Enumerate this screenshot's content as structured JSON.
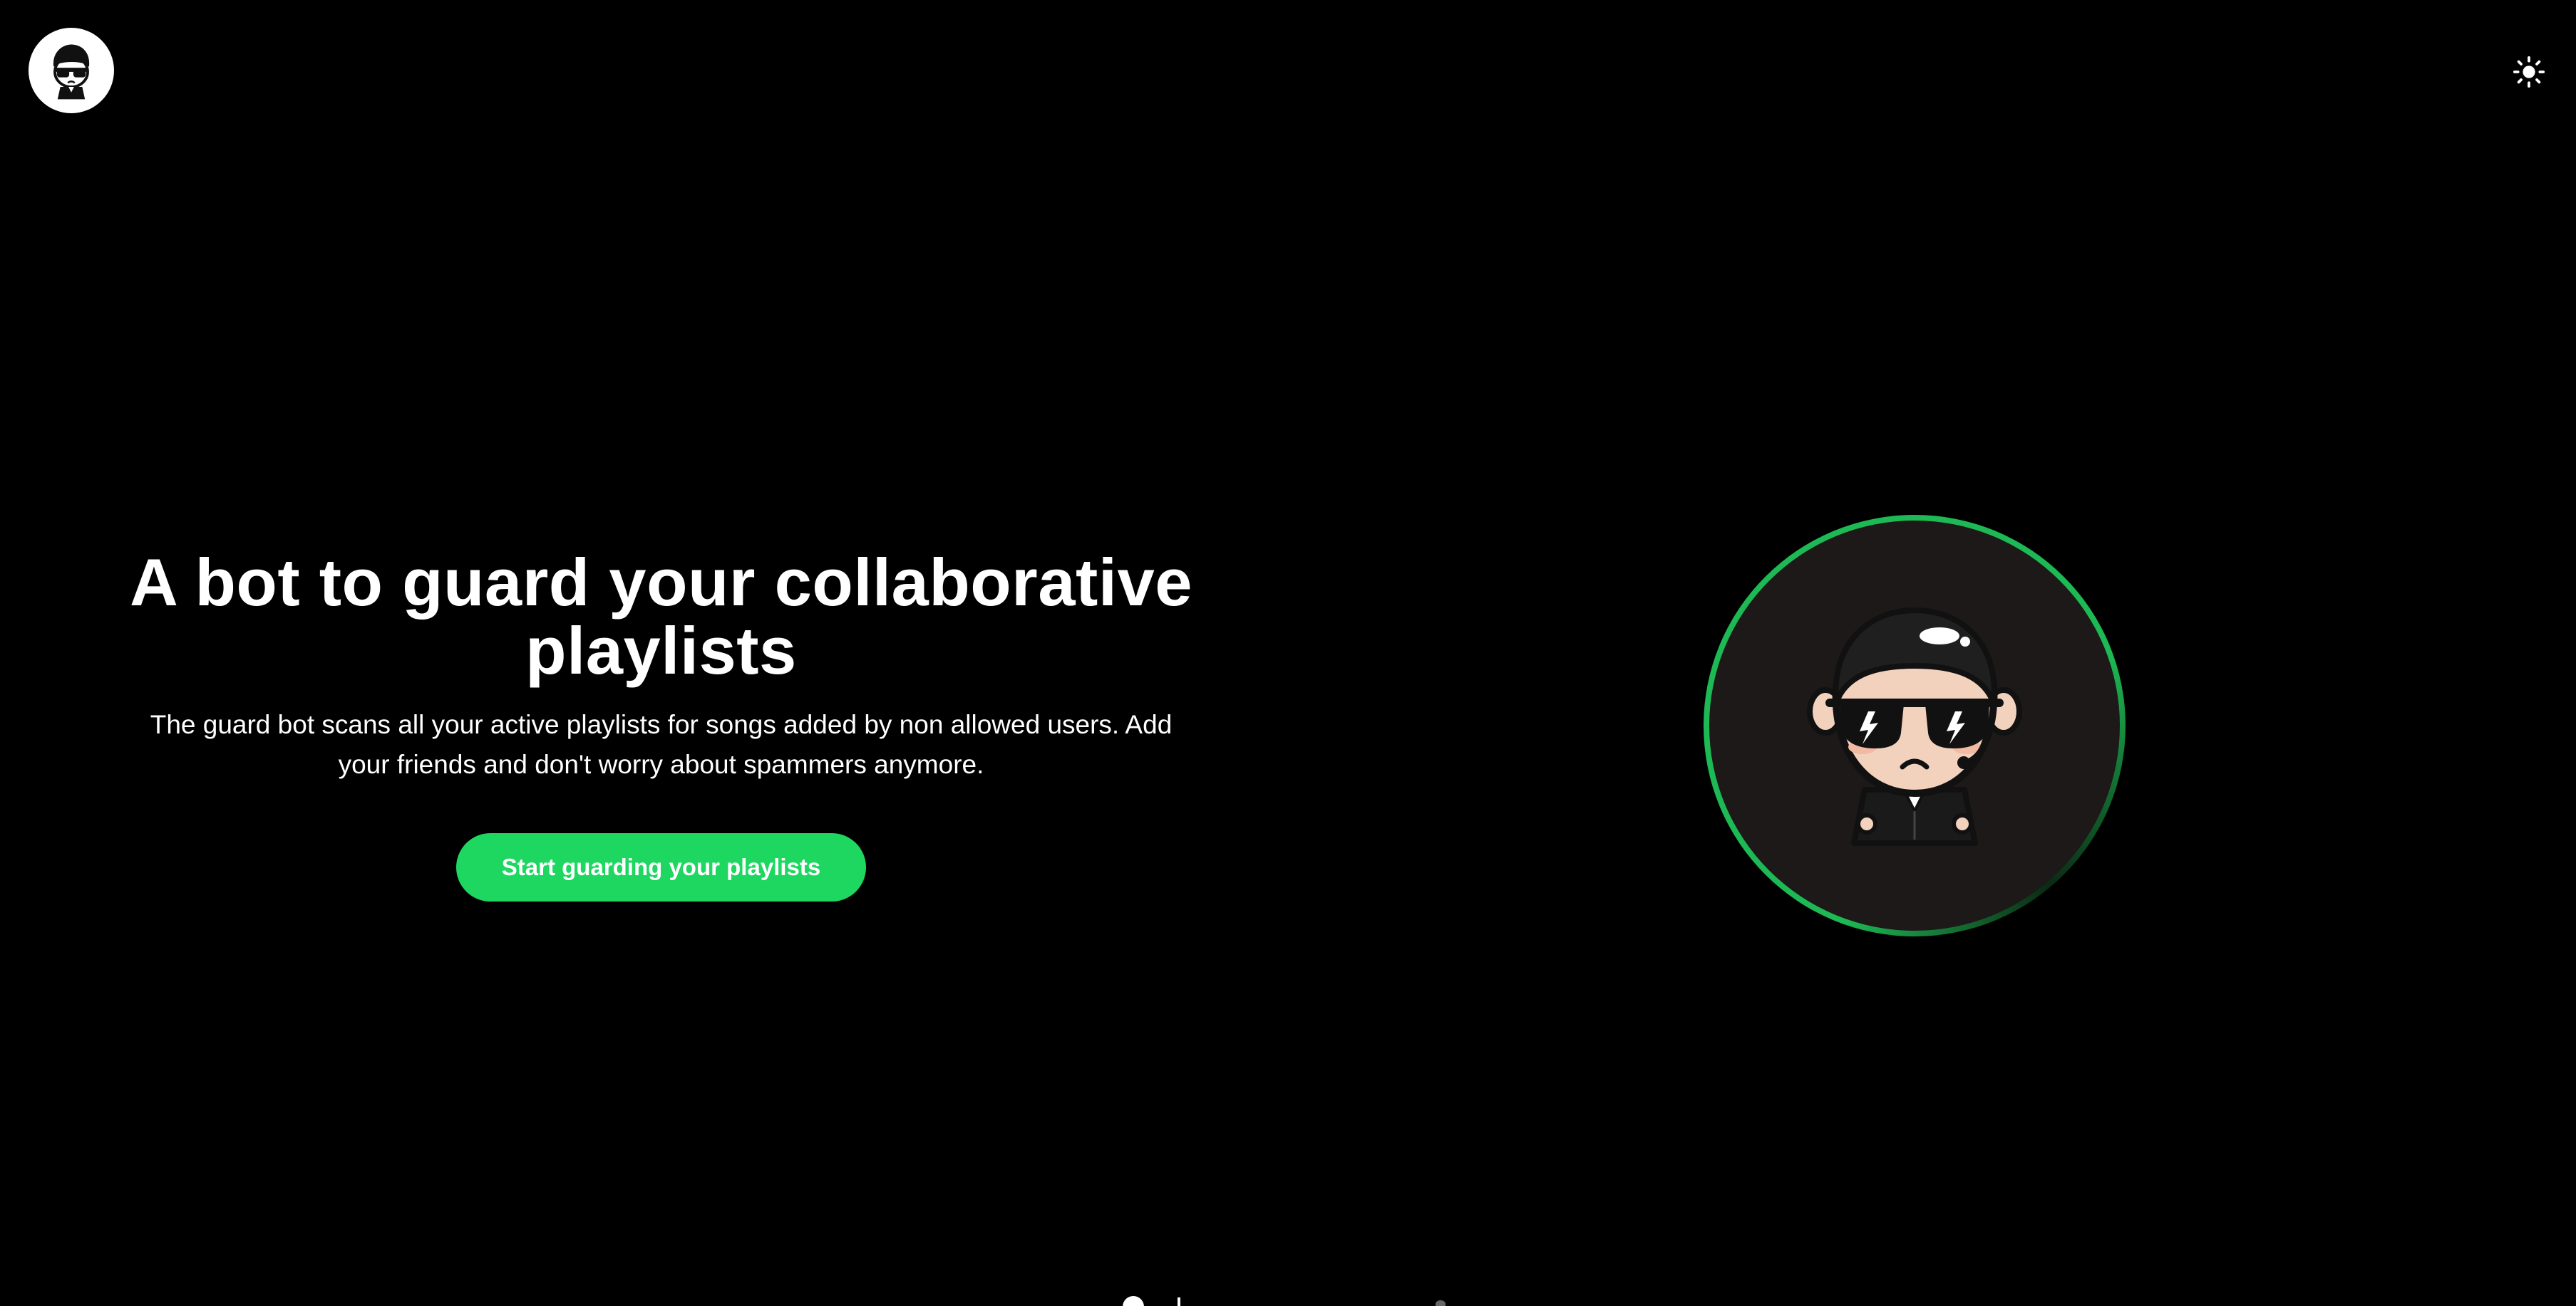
{
  "header": {
    "logo_icon": "guard-bot-logo-icon",
    "theme_toggle_icon": "sun-icon"
  },
  "hero": {
    "title": "A bot to guard your collaborative playlists",
    "subtitle": "The guard bot scans all your active playlists for songs added by non allowed users. Add your friends and don't worry about spammers anymore.",
    "cta_label": "Start guarding your playlists"
  },
  "illustration": {
    "icon": "guard-bot-mascot-icon",
    "ring_color": "#1db954",
    "background_color": "#1c1918"
  },
  "colors": {
    "accent": "#1ed760",
    "page_background": "#000000",
    "text": "#ffffff"
  }
}
